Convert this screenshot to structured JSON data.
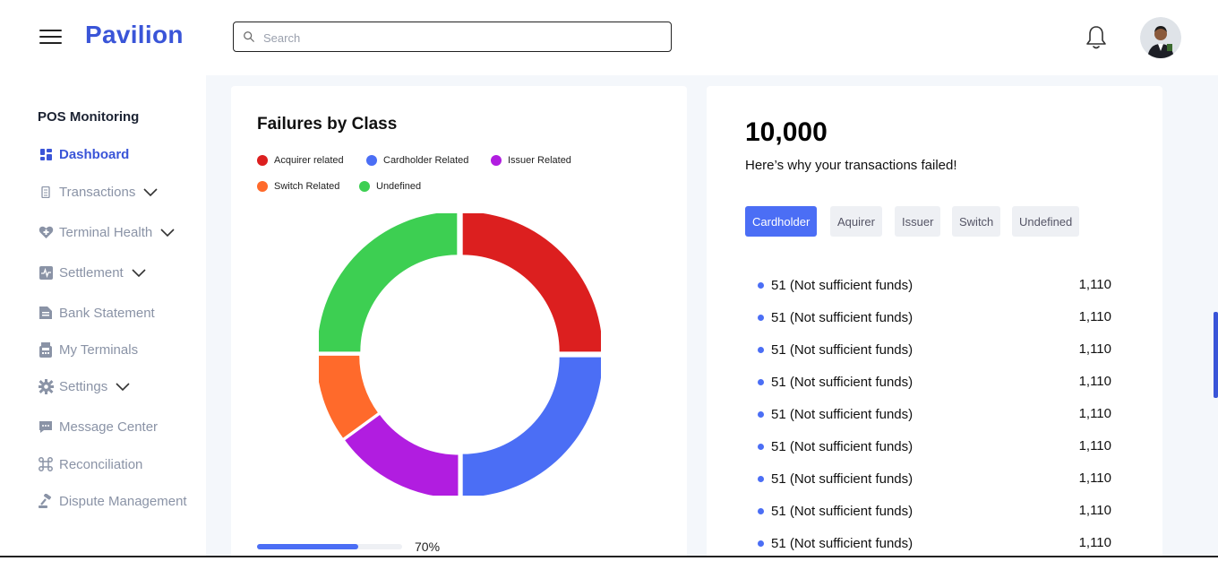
{
  "header": {
    "brand": "Pavilion",
    "search_placeholder": "Search"
  },
  "sidebar": {
    "section_title": "POS Monitoring",
    "items": [
      {
        "label": "Dashboard",
        "icon": "dashboard-icon",
        "active": true,
        "expandable": false
      },
      {
        "label": "Transactions",
        "icon": "receipt-icon",
        "active": false,
        "expandable": true
      },
      {
        "label": "Terminal Health",
        "icon": "heart-plus-icon",
        "active": false,
        "expandable": true
      },
      {
        "label": "Settlement",
        "icon": "pulse-chart-icon",
        "active": false,
        "expandable": true
      },
      {
        "label": "Bank Statement",
        "icon": "document-icon",
        "active": false,
        "expandable": false
      },
      {
        "label": "My Terminals",
        "icon": "pos-terminal-icon",
        "active": false,
        "expandable": false
      },
      {
        "label": "Settings",
        "icon": "gear-icon",
        "active": false,
        "expandable": true
      },
      {
        "label": "Message Center",
        "icon": "chat-icon",
        "active": false,
        "expandable": false
      },
      {
        "label": "Reconciliation",
        "icon": "network-icon",
        "active": false,
        "expandable": false
      },
      {
        "label": "Dispute Management",
        "icon": "gavel-icon",
        "active": false,
        "expandable": false
      }
    ]
  },
  "failures_card": {
    "title": "Failures by Class",
    "progress_label": "70%",
    "progress_value": 0.7
  },
  "chart_data": {
    "type": "pie",
    "title": "Failures by Class",
    "series": [
      {
        "name": "Acquirer related",
        "value": 25,
        "color": "#dc1f1f"
      },
      {
        "name": "Cardholder Related",
        "value": 25,
        "color": "#4b6ef5"
      },
      {
        "name": "Issuer Related",
        "value": 15,
        "color": "#b11de0"
      },
      {
        "name": "Switch Related",
        "value": 10,
        "color": "#ff6a2b"
      },
      {
        "name": "Undefined",
        "value": 25,
        "color": "#3dcf52"
      }
    ],
    "legend": [
      "Acquirer related",
      "Cardholder Related",
      "Issuer Related",
      "Switch Related",
      "Undefined"
    ]
  },
  "summary_card": {
    "total": "10,000",
    "subtitle": "Here’s why your transactions failed!",
    "tabs": [
      {
        "label": "Cardholder",
        "active": true
      },
      {
        "label": "Aquirer",
        "active": false
      },
      {
        "label": "Issuer",
        "active": false
      },
      {
        "label": "Switch",
        "active": false
      },
      {
        "label": "Undefined",
        "active": false
      }
    ],
    "reasons": [
      {
        "label": "51 (Not sufficient funds)",
        "value": "1,110"
      },
      {
        "label": "51 (Not sufficient funds)",
        "value": "1,110"
      },
      {
        "label": "51 (Not sufficient funds)",
        "value": "1,110"
      },
      {
        "label": "51 (Not sufficient funds)",
        "value": "1,110"
      },
      {
        "label": "51 (Not sufficient funds)",
        "value": "1,110"
      },
      {
        "label": "51 (Not sufficient funds)",
        "value": "1,110"
      },
      {
        "label": "51 (Not sufficient funds)",
        "value": "1,110"
      },
      {
        "label": "51 (Not sufficient funds)",
        "value": "1,110"
      },
      {
        "label": "51 (Not sufficient funds)",
        "value": "1,110"
      }
    ]
  },
  "colors": {
    "accent": "#3a55d8",
    "primary_blue": "#4b6ef5",
    "background": "#f4f7fb"
  }
}
